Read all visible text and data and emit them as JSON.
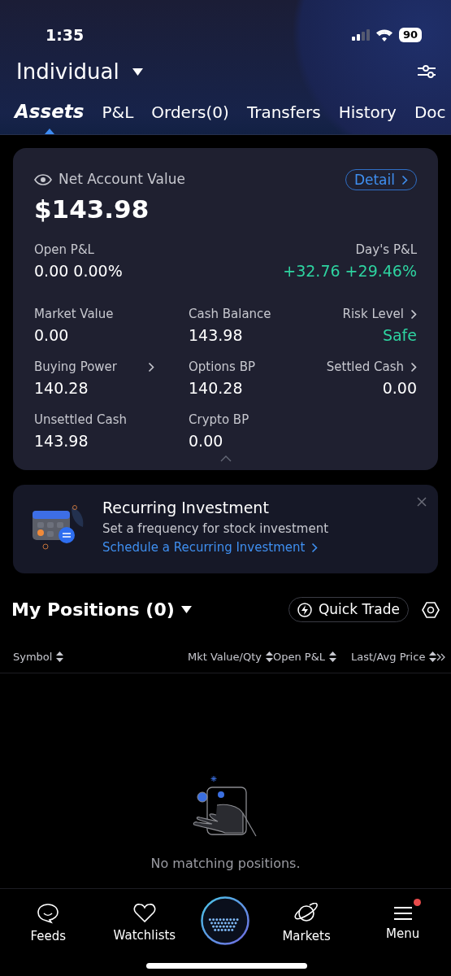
{
  "status_bar": {
    "time": "1:35",
    "battery": "90"
  },
  "header": {
    "account": "Individual"
  },
  "tabs": [
    {
      "label": "Assets",
      "selected": true
    },
    {
      "label": "P&L",
      "selected": false
    },
    {
      "label": "Orders(0)",
      "selected": false
    },
    {
      "label": "Transfers",
      "selected": false
    },
    {
      "label": "History",
      "selected": false
    },
    {
      "label": "Doc",
      "selected": false
    }
  ],
  "account_card": {
    "label": "Net Account Value",
    "value": "$143.98",
    "detail_button": "Detail",
    "open_pnl": {
      "label": "Open P&L",
      "value": "0.00 0.00%",
      "positive": false
    },
    "days_pnl": {
      "label": "Day's P&L",
      "value": "+32.76 +29.46%",
      "positive": true
    },
    "metrics": [
      {
        "label": "Market Value",
        "value": "0.00",
        "link": false,
        "positive": false
      },
      {
        "label": "Cash Balance",
        "value": "143.98",
        "link": false,
        "positive": false
      },
      {
        "label": "Risk Level",
        "value": "Safe",
        "link": true,
        "positive": true
      },
      {
        "label": "Buying Power",
        "value": "140.28",
        "link": true,
        "positive": false
      },
      {
        "label": "Options BP",
        "value": "140.28",
        "link": false,
        "positive": false
      },
      {
        "label": "Settled Cash",
        "value": "0.00",
        "link": true,
        "positive": false
      },
      {
        "label": "Unsettled Cash",
        "value": "143.98",
        "link": false,
        "positive": false
      },
      {
        "label": "Crypto BP",
        "value": "0.00",
        "link": false,
        "positive": false
      }
    ]
  },
  "banner": {
    "title": "Recurring Investment",
    "text": "Set a frequency for stock investment",
    "link": "Schedule a Recurring Investment"
  },
  "positions": {
    "title": "My Positions (0)",
    "quick_trade": "Quick Trade",
    "columns": [
      "Symbol",
      "Mkt Value/Qty",
      "Open P&L",
      "Last/Avg Price"
    ],
    "empty_text": "No matching positions."
  },
  "bottom_nav": [
    {
      "kind": "feeds",
      "label": "Feeds",
      "badge": false
    },
    {
      "kind": "watchlists",
      "label": "Watchlists",
      "badge": false
    },
    {
      "kind": "center"
    },
    {
      "kind": "markets",
      "label": "Markets",
      "badge": false
    },
    {
      "kind": "menu",
      "label": "Menu",
      "badge": true
    }
  ]
}
